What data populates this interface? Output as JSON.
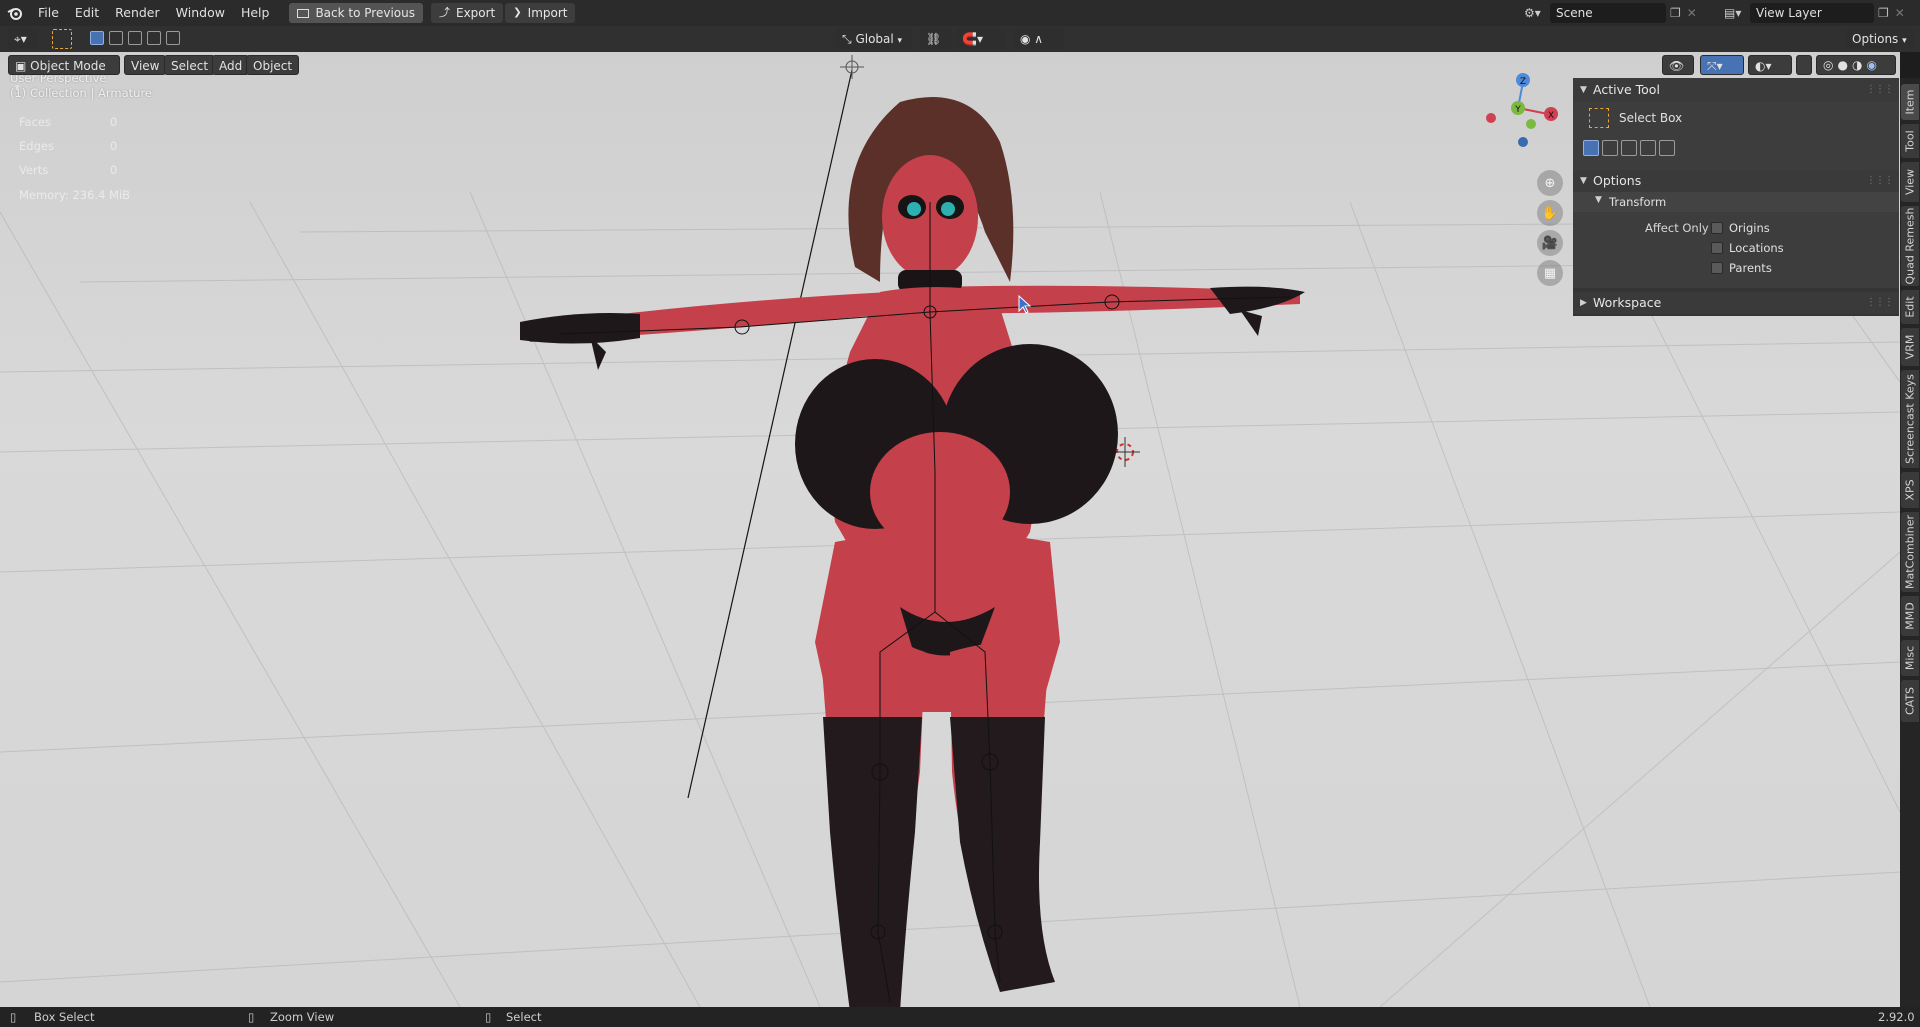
{
  "menu": {
    "items": [
      "File",
      "Edit",
      "Render",
      "Window",
      "Help"
    ],
    "back_to_previous": "Back to Previous",
    "export": "Export",
    "import": "Import"
  },
  "scene": {
    "label": "Scene",
    "view_layer": "View Layer"
  },
  "header": {
    "transform_orientation": "Global",
    "options": "Options"
  },
  "viewport_header": {
    "mode": "Object Mode",
    "view": "View",
    "select": "Select",
    "add": "Add",
    "object": "Object"
  },
  "overlay": {
    "perspective": "User Perspective",
    "collection": "(1) Collection | Armature",
    "stats": [
      {
        "label": "Faces",
        "value": "0"
      },
      {
        "label": "Edges",
        "value": "0"
      },
      {
        "label": "Verts",
        "value": "0"
      }
    ],
    "memory": "Memory: 236.4 MiB"
  },
  "gizmo": {
    "x": "X",
    "y": "Y",
    "z": "Z"
  },
  "npanel": {
    "active_tool": "Active Tool",
    "select_box": "Select Box",
    "options": "Options",
    "transform": "Transform",
    "affect_only": "Affect Only",
    "origins": "Origins",
    "locations": "Locations",
    "parents": "Parents",
    "workspace": "Workspace"
  },
  "vtabs": [
    "Item",
    "Tool",
    "View",
    "Quad Remesh",
    "Edit",
    "VRM",
    "Screencast Keys",
    "XPS",
    "MatCombiner",
    "MMD",
    "Misc",
    "CATS"
  ],
  "status": {
    "box_select": "Box Select",
    "zoom_view": "Zoom View",
    "select": "Select",
    "version": "2.92.0"
  },
  "colors": {
    "accent": "#4772b3",
    "viewport_bg": "#d3d3d3",
    "character_skin": "#c4404a",
    "character_dark": "#1c1518"
  }
}
